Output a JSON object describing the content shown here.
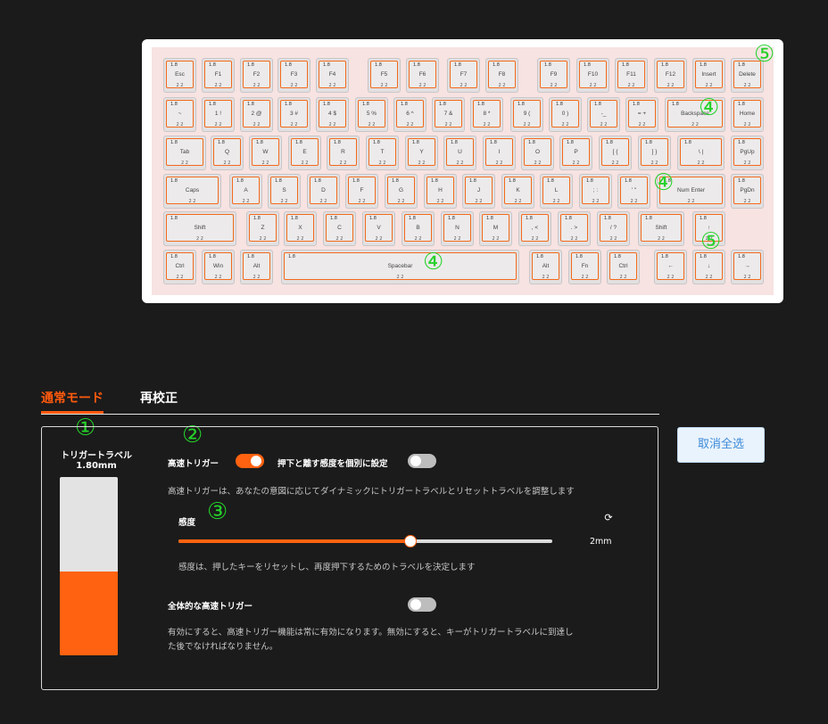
{
  "keyboard": {
    "travel_value": "1.8",
    "rt_value": "2 2",
    "rows": [
      [
        "Esc",
        "F1",
        "F2",
        "F3",
        "F4",
        "F5",
        "F6",
        "F7",
        "F8",
        "F9",
        "F10",
        "F11",
        "F12",
        "Insert",
        "Delete"
      ],
      [
        "~",
        "1 !",
        "2 @",
        "3 #",
        "4 $",
        "5 %",
        "6 ^",
        "7 &",
        "8 *",
        "9 (",
        "0 )",
        "-_",
        "= +",
        "Backspace",
        "Home"
      ],
      [
        "Tab",
        "Q",
        "W",
        "E",
        "R",
        "T",
        "Y",
        "U",
        "I",
        "O",
        "P",
        "[ {",
        "] }",
        "\\ |",
        "PgUp"
      ],
      [
        "Caps",
        "A",
        "S",
        "D",
        "F",
        "G",
        "H",
        "J",
        "K",
        "L",
        "; :",
        "' \"",
        "Num Enter",
        "PgDn"
      ],
      [
        "Shift",
        "Z",
        "X",
        "C",
        "V",
        "B",
        "N",
        "M",
        ", <",
        ". >",
        "/ ?",
        "Shift",
        "↑"
      ],
      [
        "Ctrl",
        "Win",
        "Alt",
        "Spacebar",
        "Alt",
        "Fn",
        "Ctrl",
        "←",
        "↓",
        "→"
      ]
    ]
  },
  "markers": {
    "m1": "①",
    "m2": "②",
    "m3": "③",
    "m4": "④",
    "m5": "⑤"
  },
  "tabs": {
    "normal": "通常モード",
    "recalibrate": "再校正"
  },
  "travel": {
    "title": "トリガートラベル",
    "value": "1.80mm",
    "fill_fraction": 0.47
  },
  "rapid_trigger": {
    "label": "高速トリガー",
    "enabled": true
  },
  "separate_sensitivity": {
    "label": "押下と離す感度を個別に設定",
    "enabled": false
  },
  "rapid_desc": "高速トリガーは、あなたの意図に応じてダイナミックにトリガートラベルとリセットトラベルを調整します",
  "sensitivity": {
    "label": "感度",
    "value_text": "2mm",
    "fraction": 0.62,
    "desc": "感度は、押したキーをリセットし、再度押下するためのトラベルを決定します"
  },
  "global_rt": {
    "label": "全体的な高速トリガー",
    "enabled": false,
    "desc_line1": "有効にすると、高速トリガー機能は常に有効になります。無効にすると、キーがトリガートラベルに到達し",
    "desc_line2": "た後でなければなりません。"
  },
  "deselect_button": "取消全选",
  "colors": {
    "accent": "#ff5a0e",
    "key_border": "#f26a1b",
    "button_text": "#3c8ad8"
  }
}
